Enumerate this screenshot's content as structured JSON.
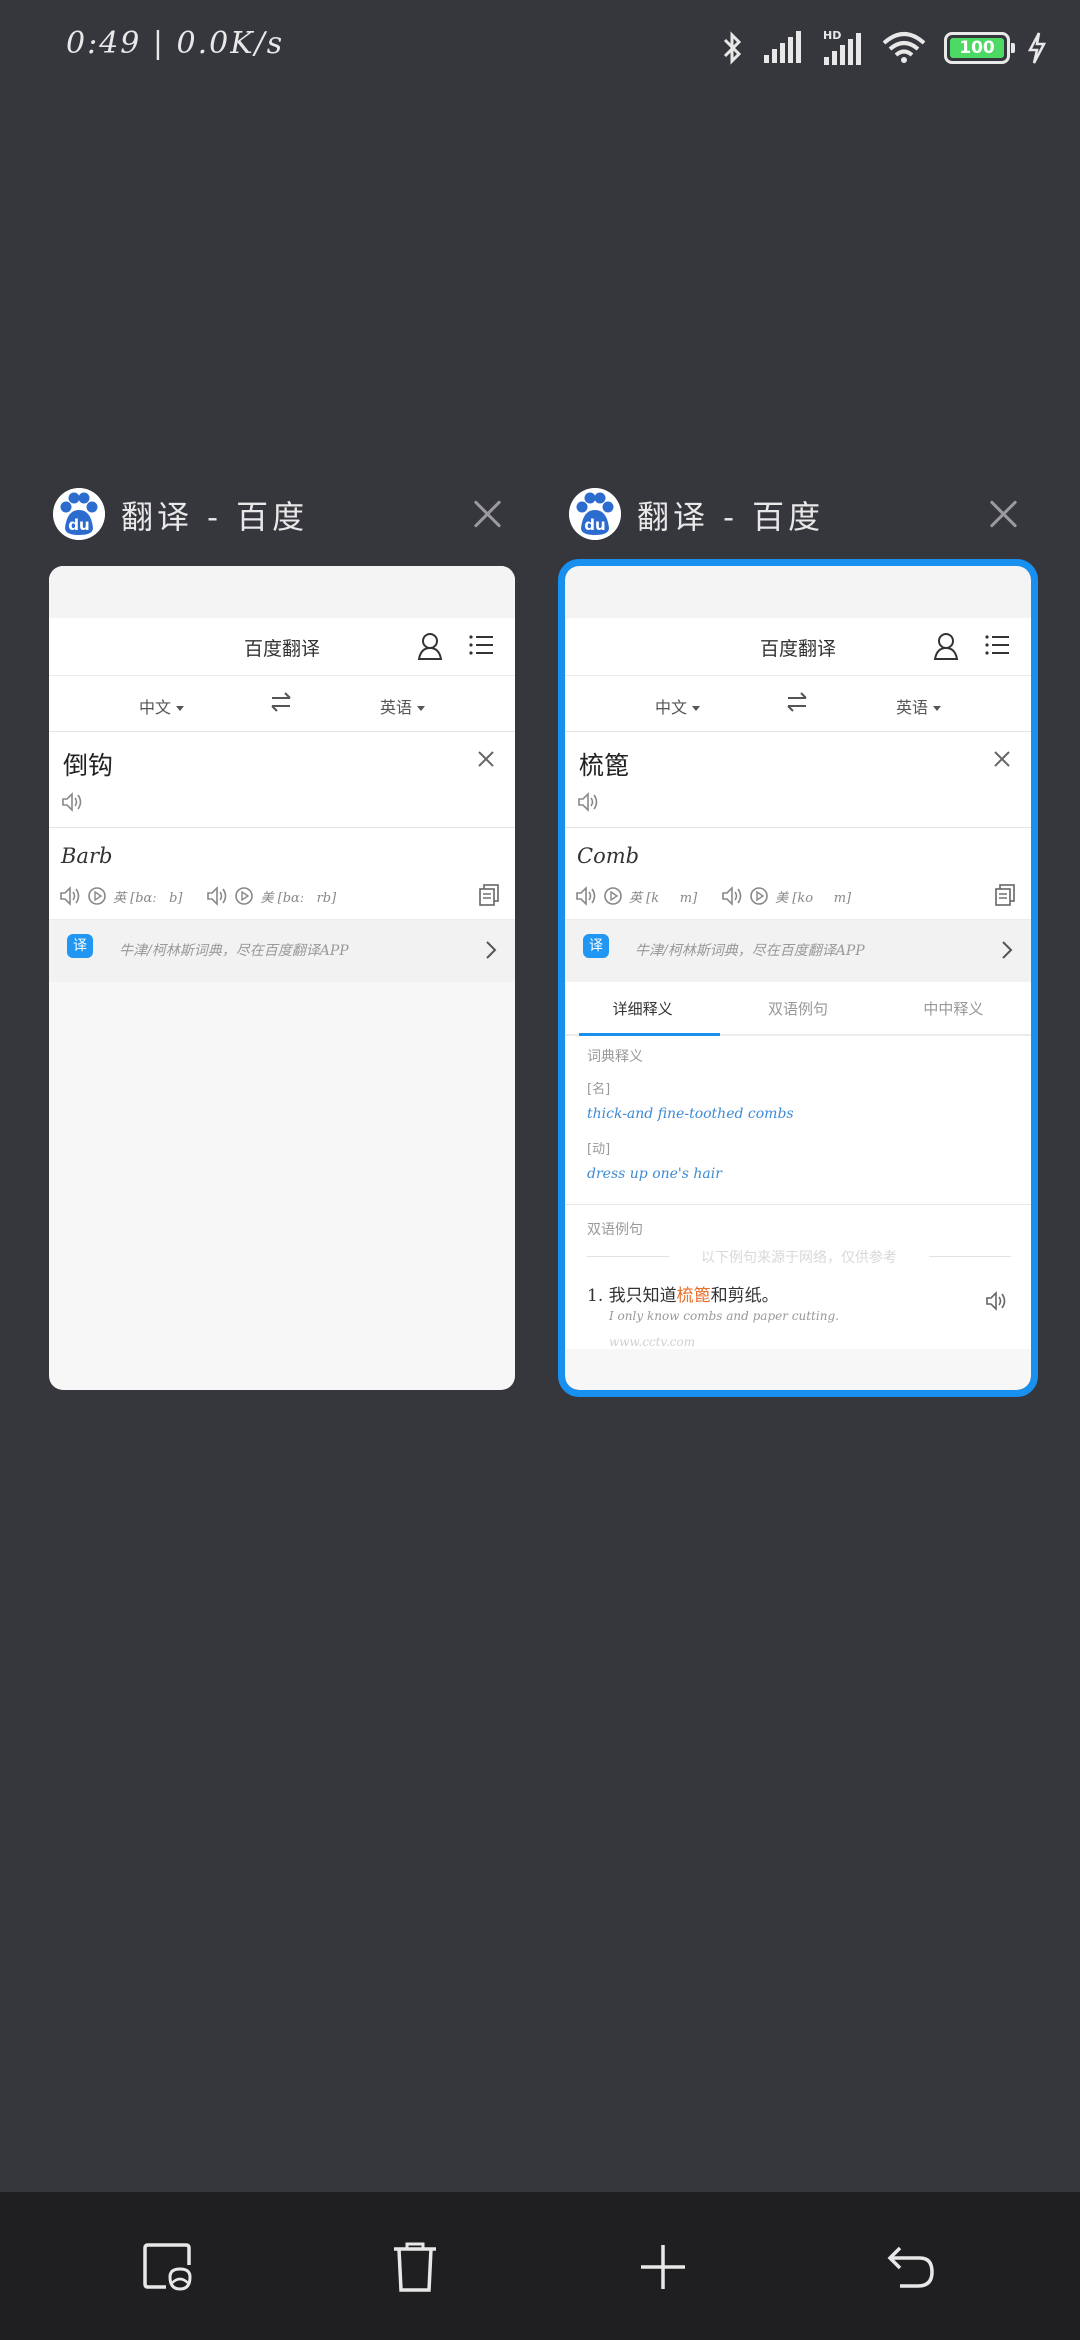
{
  "status_bar": {
    "time": "0:49 | 0.0K/s",
    "battery": "100",
    "icons": [
      "bluetooth-icon",
      "signal-icon",
      "hd-signal-icon",
      "wifi-icon",
      "battery-icon",
      "charging-icon"
    ]
  },
  "colors": {
    "background": "#36363d",
    "accent": "#1890f0",
    "bottom_bar": "#1f1f22",
    "highlight": "#e8702a",
    "definition": "#3d8bd6"
  },
  "tabs": [
    {
      "favicon": "baidu-paw-icon",
      "favicon_label": "du",
      "title": "翻译 - 百度",
      "site_title": "百度翻译",
      "lang_source": "中文",
      "lang_target": "英语",
      "input": "倒钩",
      "result": "Barb",
      "phonetic_uk": "英 [bɑː   b]",
      "phonetic_us": "美 [bɑː   rb]",
      "promo": "牛津/柯林斯词典，尽在百度翻译APP",
      "promo_badge": "译"
    },
    {
      "favicon": "baidu-paw-icon",
      "favicon_label": "du",
      "title": "翻译 - 百度",
      "site_title": "百度翻译",
      "lang_source": "中文",
      "lang_target": "英语",
      "input": "梳篦",
      "result": "Comb",
      "phonetic_uk": "英 [k     m]",
      "phonetic_us": "美 [ko     m]",
      "promo": "牛津/柯林斯词典，尽在百度翻译APP",
      "promo_badge": "译",
      "detail_tabs": [
        "详细释义",
        "双语例句",
        "中中释义"
      ],
      "dict_heading": "词典释义",
      "dict_entries": [
        {
          "pos": "[名]",
          "def": "thick-and fine-toothed combs"
        },
        {
          "pos": "[动]",
          "def": "dress up one's hair"
        }
      ],
      "sentences_heading": "双语例句",
      "sentences_note": "以下例句来源于网络，仅供参考",
      "sentence": {
        "num": "1.",
        "cn_before": "我只知道",
        "cn_highlight": "梳篦",
        "cn_after": "和剪纸。",
        "en": "I only know combs and paper cutting.",
        "source": "www.cctv.com"
      }
    }
  ],
  "bottom_bar": {
    "buttons": [
      "small-window-icon",
      "delete-icon",
      "new-tab-icon",
      "back-icon"
    ]
  }
}
